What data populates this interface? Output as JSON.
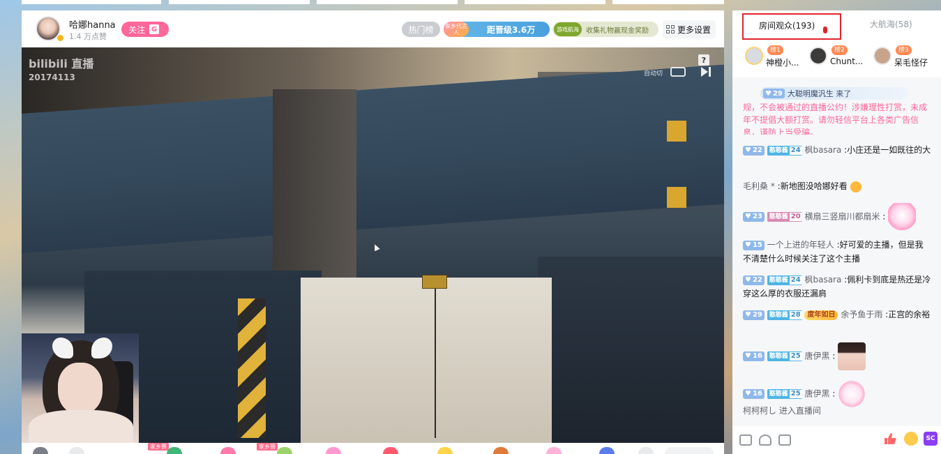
{
  "streamer": {
    "name": "哈娜hanna",
    "likes": "1.4 万点赞",
    "follow_label": "关注",
    "follow_badge": "G"
  },
  "header": {
    "hot_label": "热门榜",
    "rank_icon_text": "家乡代言人",
    "rank_label": "距晋级3.6万",
    "gift_icon_text": "游戏航海",
    "gift_label": "收集礼物赢现金奖励",
    "settings_label": "更多设置"
  },
  "video": {
    "watermark": "bilibili 直播",
    "date_stamp": "20174113",
    "help": "?",
    "auto_switch": "自动切"
  },
  "giftbar": {
    "tags": [
      "家乡赛",
      "家乡赛"
    ]
  },
  "sidebar": {
    "tab_audience": "房间观众(193)",
    "tab_fleet": "大航海(58)",
    "ranks": [
      {
        "rank": "榜1",
        "name": "神橙小..."
      },
      {
        "rank": "榜2",
        "name": "Chunt..."
      },
      {
        "rank": "榜3",
        "name": "呆毛怪仔"
      }
    ]
  },
  "chat": {
    "enter": {
      "level": "29",
      "text": "大聪明魔汎生  来了"
    },
    "notice": "规，不会被通过的直播公约！涉嫌理性打赏，未成年不提倡大额打赏。请勿轻信平台上各类广告信息，谨防上当受骗。",
    "messages": [
      {
        "level": "22",
        "medal": "憨憨酱",
        "medal_level": "24",
        "user": "枫basara",
        "content": ":小庄还是一如既往的大"
      },
      {
        "user": "毛利桑 *",
        "content": ":新地图没哈娜好看"
      },
      {
        "level": "23",
        "medal": "憨憨酱",
        "medal_level": "20",
        "user": "横扇三竖扇川都扇米",
        "content": ":"
      },
      {
        "level": "15",
        "user": "一个上进的年轻人",
        "content": ":好可爱的主播，但是我不清楚什么时候关注了这个主播"
      },
      {
        "level": "22",
        "medal": "憨憨酱",
        "medal_level": "24",
        "user": "枫basara",
        "content": ":佩利卡到底是热还是冷 穿这么厚的衣服还漏肩"
      },
      {
        "level": "29",
        "medal": "憨憨酱",
        "medal_level": "28",
        "title": "度年如日",
        "user": "余予鱼于雨",
        "content": ":正宫的余裕"
      },
      {
        "level": "16",
        "medal": "憨憨酱",
        "medal_level": "25",
        "user": "唐伊黑",
        "content": ":"
      },
      {
        "level": "16",
        "medal": "憨憨酱",
        "medal_level": "25",
        "user": "唐伊黑",
        "content": ":"
      }
    ],
    "enter2": "柯柯柯し  进入直播间"
  },
  "bottom": {
    "sc_label": "SC"
  }
}
